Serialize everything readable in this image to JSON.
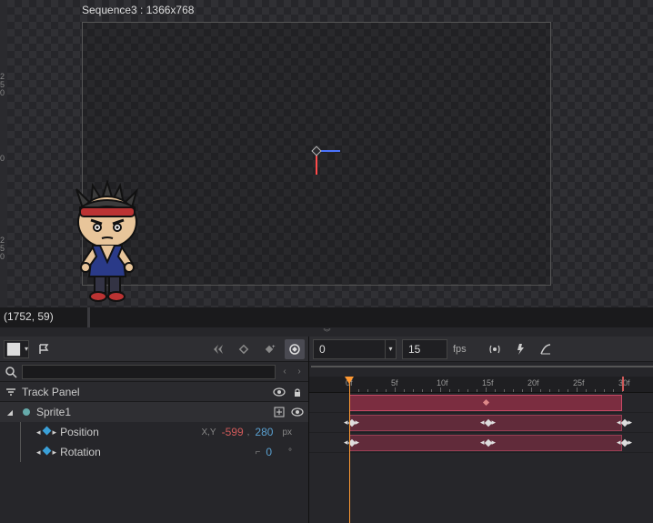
{
  "canvas": {
    "sequence_label": "Sequence3 : 1366x768",
    "cursor_coords": "(1752, 59)",
    "ruler_zero": "0",
    "ruler_250a": "2\n5\n0",
    "ruler_250b": "2\n5\n0"
  },
  "track_toolbar": {
    "view_mode": "rect",
    "flag": "flag"
  },
  "playback": {
    "current_frame": "0",
    "fps_value": "15",
    "fps_label": "fps"
  },
  "search": {
    "placeholder": ""
  },
  "track_panel": {
    "label": "Track Panel"
  },
  "tracks": {
    "sprite": {
      "name": "Sprite1"
    },
    "position": {
      "name": "Position",
      "axis_label": "X,Y",
      "x": "-599",
      "y": "280",
      "unit": "px"
    },
    "rotation": {
      "name": "Rotation",
      "value": "0",
      "unit": "°"
    }
  },
  "timeline": {
    "ticks": [
      "0f",
      "5f",
      "10f",
      "15f",
      "20f",
      "25f",
      "30f"
    ],
    "region_start_f": 0,
    "region_end_f": 30,
    "playhead_f": 0,
    "pos_keys_f": [
      0,
      15,
      30
    ],
    "rot_keys_f": [
      0,
      15,
      30
    ]
  },
  "icons": {
    "search": "search-icon",
    "filter": "filter-icon",
    "eye": "eye-icon",
    "lock": "lock-icon",
    "add": "plus-box-icon",
    "target": "target-icon",
    "bolt": "bolt-icon",
    "curve": "curve-icon",
    "diamond_outline": "keyframe-outline-icon",
    "diamond_fill": "keyframe-fill-icon",
    "chev_left": "chevron-left-icon",
    "chev_right": "chevron-right-icon"
  }
}
